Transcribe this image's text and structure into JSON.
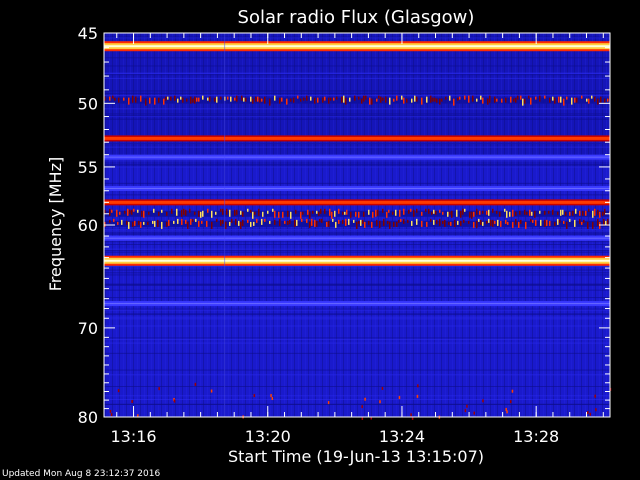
{
  "chart_data": {
    "type": "heatmap",
    "title": "Solar radio Flux (Glasgow)",
    "xlabel": "Start Time (19-Jun-13 13:15:07)",
    "ylabel": "Frequency [MHz]",
    "x_start_minutes": 15.12,
    "x_end_minutes": 30.2,
    "x_ticks": [
      {
        "label": "13:16",
        "minutes": 16
      },
      {
        "label": "13:20",
        "minutes": 20
      },
      {
        "label": "13:24",
        "minutes": 24
      },
      {
        "label": "13:28",
        "minutes": 28
      }
    ],
    "y_range": [
      45,
      80
    ],
    "y_scale": "log",
    "y_ticks": [
      45,
      50,
      55,
      60,
      70,
      80
    ],
    "background_color": "#1a1acc",
    "emission_bands": [
      {
        "freq_mhz": 45.9,
        "intensity": "strong"
      },
      {
        "freq_mhz": 49.8,
        "intensity": "bursty"
      },
      {
        "freq_mhz": 52.7,
        "intensity": "medium"
      },
      {
        "freq_mhz": 54.2,
        "intensity": "weak"
      },
      {
        "freq_mhz": 56.8,
        "intensity": "weak"
      },
      {
        "freq_mhz": 58.0,
        "intensity": "medium"
      },
      {
        "freq_mhz": 59.0,
        "intensity": "bursty"
      },
      {
        "freq_mhz": 59.9,
        "intensity": "bursty"
      },
      {
        "freq_mhz": 61.2,
        "intensity": "weak"
      },
      {
        "freq_mhz": 63.3,
        "intensity": "strong"
      },
      {
        "freq_mhz": 67.5,
        "intensity": "weak"
      }
    ]
  },
  "footer": "Updated Mon Aug  8 23:12:37 2016"
}
